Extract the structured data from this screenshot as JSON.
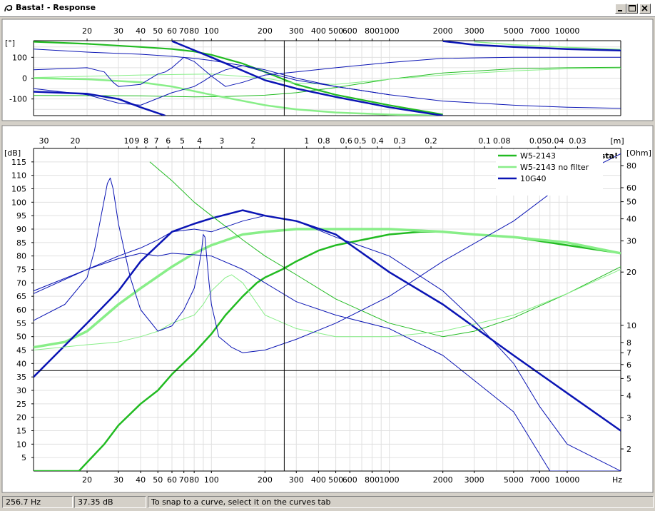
{
  "window": {
    "title": "Basta! - Response"
  },
  "status": {
    "frequency": "256.7 Hz",
    "level": "37.35 dB",
    "hint": "To snap to a curve, select it on the curves tab"
  },
  "colors": {
    "w5": "#22bb22",
    "w5_nofilter": "#88ee88",
    "g40": "#0a14b4",
    "cursor": "#000000",
    "grid": "#e0e0e0"
  },
  "chart_data": [
    {
      "name": "phase",
      "type": "line",
      "ylabel": "[°]",
      "ylim": [
        -180,
        180
      ],
      "yticks": [
        -100,
        0,
        100
      ],
      "xscale": "log",
      "xlim": [
        10,
        20000
      ],
      "xtick_labels": [
        "20",
        "30",
        "40",
        "50",
        "60",
        "70",
        "80",
        "100",
        "200",
        "300",
        "400",
        "500",
        "600",
        "800",
        "1000",
        "2000",
        "3000",
        "5000",
        "7000",
        "10000"
      ],
      "cursor_hz": 256.7,
      "series": [
        {
          "name": "W5-2143",
          "color": "#22bb22",
          "width": 2.2,
          "x": [
            10,
            20,
            40,
            60,
            80,
            100,
            150,
            200,
            300,
            500,
            1000,
            2000
          ],
          "y": [
            175,
            165,
            150,
            140,
            128,
            112,
            70,
            30,
            -30,
            -80,
            -130,
            -175
          ]
        },
        {
          "color": "#22bb22",
          "width": 1,
          "x": [
            10,
            40,
            80,
            120,
            200,
            300,
            500,
            1000,
            2000,
            5000,
            10000,
            20000
          ],
          "y": [
            -83,
            -85,
            -90,
            -88,
            -82,
            -70,
            -45,
            -5,
            25,
            45,
            50,
            52
          ]
        },
        {
          "name": "W5-2143 no filter",
          "color": "#88ee88",
          "width": 2.5,
          "x": [
            10,
            20,
            40,
            60,
            100,
            200,
            300,
            500,
            1000,
            2000
          ],
          "y": [
            0,
            -5,
            -20,
            -40,
            -80,
            -130,
            -150,
            -165,
            -175,
            -180
          ]
        },
        {
          "color": "#88ee88",
          "width": 1,
          "x": [
            10,
            40,
            100,
            200,
            300,
            500,
            1000,
            2000,
            5000,
            10000,
            20000
          ],
          "y": [
            3,
            15,
            20,
            0,
            -25,
            -30,
            -5,
            15,
            35,
            45,
            48
          ]
        },
        {
          "color": "#88ee88",
          "width": 1.5,
          "x": [
            3000,
            5000,
            10000,
            20000
          ],
          "y": [
            175,
            160,
            148,
            138
          ]
        },
        {
          "name": "10G40",
          "color": "#0a14b4",
          "width": 2.5,
          "x": [
            60,
            100,
            200,
            300,
            500,
            1000,
            2000
          ],
          "y": [
            178,
            100,
            -10,
            -50,
            -90,
            -140,
            -180
          ]
        },
        {
          "color": "#0a14b4",
          "width": 2.5,
          "x": [
            2000,
            3000,
            5000,
            10000,
            20000
          ],
          "y": [
            178,
            160,
            150,
            140,
            133
          ]
        },
        {
          "color": "#0a14b4",
          "width": 2.5,
          "x": [
            10,
            20,
            30,
            40,
            55
          ],
          "y": [
            -65,
            -75,
            -100,
            -140,
            -180
          ]
        },
        {
          "color": "#0a14b4",
          "width": 1,
          "x": [
            10,
            20,
            25,
            28,
            30,
            40,
            50,
            55,
            60,
            70,
            80,
            100,
            120,
            150,
            200,
            300,
            500,
            1000,
            2000,
            5000,
            10000,
            20000
          ],
          "y": [
            40,
            50,
            30,
            -20,
            -40,
            -30,
            20,
            30,
            50,
            100,
            80,
            10,
            -40,
            -20,
            15,
            30,
            50,
            75,
            95,
            100,
            100,
            100
          ]
        },
        {
          "color": "#0a14b4",
          "width": 1,
          "x": [
            10,
            20,
            40,
            60,
            80,
            100,
            150,
            200,
            300,
            500,
            1000,
            2000,
            5000,
            10000,
            20000
          ],
          "y": [
            140,
            125,
            115,
            105,
            95,
            85,
            60,
            30,
            -10,
            -40,
            -80,
            -110,
            -130,
            -140,
            -145
          ]
        },
        {
          "color": "#0a14b4",
          "width": 1,
          "x": [
            10,
            20,
            30,
            40,
            60,
            80,
            90,
            100,
            120,
            150,
            200,
            300,
            500,
            1000
          ],
          "y": [
            -50,
            -80,
            -120,
            -130,
            -70,
            -40,
            -15,
            10,
            40,
            60,
            40,
            0,
            -40,
            -80
          ]
        }
      ]
    },
    {
      "name": "magnitude",
      "type": "line",
      "ylabel": "[dB]",
      "ylim": [
        0,
        120
      ],
      "yticks": [
        5,
        10,
        15,
        20,
        25,
        30,
        35,
        40,
        45,
        50,
        55,
        60,
        65,
        70,
        75,
        80,
        85,
        90,
        95,
        100,
        105,
        110,
        115
      ],
      "xscale": "log",
      "xlim": [
        10,
        20000
      ],
      "xlabel": "Hz",
      "xtick_labels": [
        "20",
        "30",
        "40",
        "50",
        "60",
        "70",
        "80",
        "100",
        "200",
        "300",
        "400",
        "500",
        "600",
        "800",
        "1000",
        "2000",
        "3000",
        "5000",
        "7000",
        "10000"
      ],
      "top_axis_label": "[m]",
      "top_tick_labels": [
        "30",
        "20",
        "10",
        "9",
        "8",
        "7",
        "6",
        "5",
        "4",
        "3",
        "2",
        "1",
        "0.8",
        "0.6",
        "0.5",
        "0.4",
        "0.3",
        "0.2",
        "0.1",
        "0.08",
        "0.05",
        "0.04",
        "0.03"
      ],
      "right_axis_label": "[Ohm]",
      "right_tick_labels": [
        "2",
        "3",
        "4",
        "5",
        "6",
        "7",
        "8",
        "10",
        "20",
        "30",
        "40",
        "50",
        "60",
        "80"
      ],
      "cursor_hz": 256.7,
      "cursor_db": 37.35,
      "watermark": "Basta!",
      "legend": {
        "position": "top-right",
        "entries": [
          {
            "label": "W5-2143",
            "color": "#22bb22",
            "width": 2.5
          },
          {
            "label": "W5-2143 no filter",
            "color": "#88ee88",
            "width": 2.5
          },
          {
            "label": "10G40",
            "color": "#0a14b4",
            "width": 2.5
          }
        ]
      },
      "series": [
        {
          "name": "W5-2143",
          "color": "#22bb22",
          "width": 2.5,
          "x": [
            10,
            15,
            18,
            25,
            30,
            40,
            50,
            60,
            80,
            100,
            120,
            150,
            180,
            200,
            250,
            300,
            400,
            500,
            1000,
            1500,
            2000,
            3000,
            5000,
            10000,
            20000
          ],
          "y": [
            0,
            0,
            0,
            10,
            17,
            25,
            30,
            36,
            44,
            51,
            58,
            65,
            70,
            72,
            75,
            78,
            82,
            84,
            88,
            89,
            89,
            88,
            87,
            84,
            81
          ]
        },
        {
          "name": "W5-2143 no filter",
          "color": "#88ee88",
          "width": 3.5,
          "x": [
            10,
            15,
            20,
            30,
            40,
            60,
            80,
            100,
            150,
            200,
            300,
            500,
            1000,
            2000,
            3000,
            5000,
            10000,
            20000
          ],
          "y": [
            46,
            48,
            52,
            62,
            68,
            76,
            81,
            84,
            88,
            89,
            90,
            90,
            90,
            89,
            88,
            87,
            85,
            81
          ]
        },
        {
          "name": "10G40",
          "color": "#0a14b4",
          "width": 2.5,
          "x": [
            10,
            20,
            30,
            40,
            60,
            80,
            100,
            150,
            200,
            300,
            500,
            1000,
            2000,
            5000,
            10000,
            20000
          ],
          "y": [
            35,
            55,
            67,
            78,
            89,
            92,
            94,
            97,
            95,
            93,
            88,
            74,
            62,
            43,
            29,
            15
          ]
        },
        {
          "color": "#22bb22",
          "width": 1,
          "x": [
            45,
            60,
            80,
            100,
            120,
            150,
            200,
            300,
            500,
            1000,
            2000,
            3000,
            5000,
            10000,
            20000
          ],
          "y": [
            115,
            108,
            100,
            95,
            91,
            86,
            80,
            73,
            64,
            55,
            50,
            52,
            57,
            66,
            76
          ]
        },
        {
          "color": "#88ee88",
          "width": 1,
          "x": [
            10,
            20,
            30,
            40,
            50,
            60,
            80,
            90,
            100,
            120,
            130,
            150,
            200,
            300,
            500,
            1000,
            2000,
            5000,
            10000,
            20000
          ],
          "y": [
            45,
            47,
            48,
            50,
            52,
            55,
            58,
            62,
            67,
            72,
            73,
            70,
            58,
            53,
            50,
            50,
            52,
            58,
            66,
            75
          ]
        },
        {
          "color": "#0a14b4",
          "width": 1,
          "x": [
            10,
            15,
            20,
            22,
            24,
            26,
            27,
            28,
            30,
            35,
            40,
            50,
            60,
            70,
            80,
            85,
            88,
            90,
            92,
            94,
            97,
            100,
            110,
            130,
            150,
            200,
            300,
            500,
            1000,
            2000,
            5000,
            10000,
            20000
          ],
          "y": [
            56,
            62,
            72,
            82,
            95,
            107,
            109,
            105,
            92,
            72,
            60,
            52,
            54,
            60,
            68,
            76,
            82,
            88,
            87,
            80,
            70,
            62,
            50,
            46,
            44,
            45,
            49,
            55,
            65,
            78,
            93,
            108,
            118
          ]
        },
        {
          "color": "#0a14b4",
          "width": 1,
          "x": [
            10,
            20,
            30,
            40,
            50,
            60,
            80,
            100,
            150,
            200,
            300,
            500,
            1000,
            2000,
            3000,
            5000,
            7000,
            10000,
            20000
          ],
          "y": [
            67,
            75,
            80,
            83,
            86,
            89,
            90,
            89,
            93,
            95,
            93,
            87,
            80,
            67,
            56,
            40,
            24,
            10,
            0
          ]
        },
        {
          "color": "#0a14b4",
          "width": 1,
          "x": [
            10,
            20,
            30,
            40,
            50,
            60,
            100,
            150,
            200,
            300,
            500,
            1000,
            2000,
            5000,
            8000,
            10000,
            20000
          ],
          "y": [
            66,
            75,
            79,
            81,
            80,
            81,
            80,
            75,
            70,
            63,
            58,
            53,
            43,
            22,
            0,
            0,
            0
          ]
        },
        {
          "color": "#000000",
          "width": 1,
          "x": [
            10,
            20000
          ],
          "y": [
            37.35,
            37.35
          ]
        }
      ]
    }
  ]
}
